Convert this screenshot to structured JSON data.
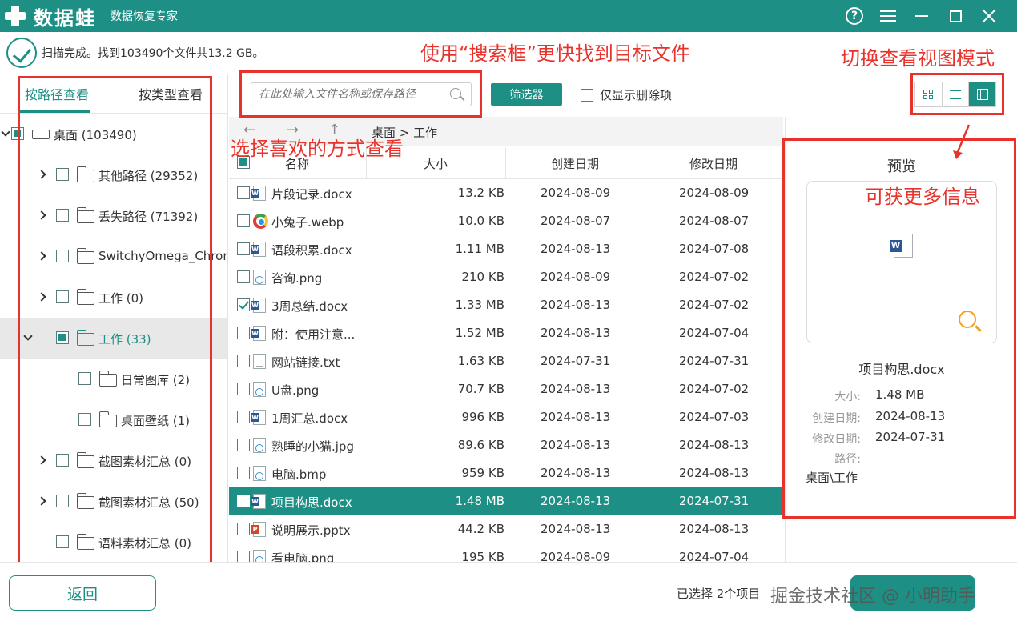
{
  "app": {
    "logo_name": "数据蛙",
    "subtitle": "数据恢复专家"
  },
  "status": {
    "text": "扫描完成。找到103490个文件共13.2 GB。"
  },
  "annotations": {
    "search_hint": "使用“搜索框”更快找到目标文件",
    "view_hint": "切换查看视图模式",
    "tree_hint": "选择喜欢的方式查看",
    "preview_hint": "可获更多信息"
  },
  "tabs": {
    "by_path": "按路径查看",
    "by_type": "按类型查看"
  },
  "tree": [
    {
      "label": "桌面 (103490)",
      "level": 0,
      "expander": "down",
      "check": "partial",
      "icon": "drive",
      "selected": false
    },
    {
      "label": "其他路径 (29352)",
      "level": 1,
      "expander": "right",
      "check": "none",
      "icon": "folder",
      "selected": false
    },
    {
      "label": "丢失路径 (71392)",
      "level": 1,
      "expander": "right",
      "check": "none",
      "icon": "folder",
      "selected": false
    },
    {
      "label": "SwitchyOmega_Chromium",
      "level": 1,
      "expander": "right",
      "check": "none",
      "icon": "folder",
      "selected": false
    },
    {
      "label": "工作 (0)",
      "level": 1,
      "expander": "right",
      "check": "none",
      "icon": "folder",
      "selected": false
    },
    {
      "label": "工作 (33)",
      "level": 1,
      "expander": "down",
      "check": "partial",
      "icon": "folder",
      "selected": true
    },
    {
      "label": "日常图库 (2)",
      "level": 2,
      "expander": "none",
      "check": "none",
      "icon": "folder",
      "selected": false
    },
    {
      "label": "桌面壁纸 (1)",
      "level": 2,
      "expander": "none",
      "check": "none",
      "icon": "folder",
      "selected": false
    },
    {
      "label": "截图素材汇总 (0)",
      "level": 1,
      "expander": "right",
      "check": "none",
      "icon": "folder",
      "selected": false
    },
    {
      "label": "截图素材汇总 (50)",
      "level": 1,
      "expander": "right",
      "check": "none",
      "icon": "folder",
      "selected": false
    },
    {
      "label": "语料素材汇总 (0)",
      "level": 1,
      "expander": "none",
      "check": "none",
      "icon": "folder",
      "selected": false
    }
  ],
  "toolbar": {
    "search_placeholder": "在此处输入文件名称或保存路径",
    "filter_label": "筛选器",
    "deleted_only_label": "仅显示删除项"
  },
  "nav": {
    "back": "←",
    "forward": "→",
    "up": "↑",
    "breadcrumb": "桌面 > 工作"
  },
  "columns": {
    "name": "名称",
    "size": "大小",
    "created": "创建日期",
    "modified": "修改日期"
  },
  "files": [
    {
      "name": "片段记录.docx",
      "type": "docx",
      "size": "13.2 KB",
      "created": "2024-08-09",
      "modified": "2024-08-09",
      "checked": false,
      "selected": false
    },
    {
      "name": "小兔子.webp",
      "type": "webp",
      "size": "10.0 KB",
      "created": "2024-08-07",
      "modified": "2024-08-07",
      "checked": false,
      "selected": false
    },
    {
      "name": "语段积累.docx",
      "type": "docx",
      "size": "1.11 MB",
      "created": "2024-08-13",
      "modified": "2024-07-08",
      "checked": false,
      "selected": false
    },
    {
      "name": "咨询.png",
      "type": "png",
      "size": "210 KB",
      "created": "2024-08-09",
      "modified": "2024-07-02",
      "checked": false,
      "selected": false
    },
    {
      "name": "3周总结.docx",
      "type": "docx",
      "size": "1.33 MB",
      "created": "2024-08-13",
      "modified": "2024-07-02",
      "checked": true,
      "selected": false
    },
    {
      "name": "附：使用注意...",
      "type": "docx",
      "size": "1.52 MB",
      "created": "2024-08-13",
      "modified": "2024-07-04",
      "checked": false,
      "selected": false
    },
    {
      "name": "网站链接.txt",
      "type": "txt",
      "size": "1.63 KB",
      "created": "2024-07-31",
      "modified": "2024-07-31",
      "checked": false,
      "selected": false
    },
    {
      "name": "U盘.png",
      "type": "png",
      "size": "70.7 KB",
      "created": "2024-08-13",
      "modified": "2024-07-02",
      "checked": false,
      "selected": false
    },
    {
      "name": "1周汇总.docx",
      "type": "docx",
      "size": "996 KB",
      "created": "2024-08-13",
      "modified": "2024-07-03",
      "checked": false,
      "selected": false
    },
    {
      "name": "熟睡的小猫.jpg",
      "type": "jpg",
      "size": "89.6 KB",
      "created": "2024-08-13",
      "modified": "2024-08-13",
      "checked": false,
      "selected": false
    },
    {
      "name": "电脑.bmp",
      "type": "bmp",
      "size": "959 KB",
      "created": "2024-08-13",
      "modified": "2024-08-13",
      "checked": false,
      "selected": false
    },
    {
      "name": "项目构思.docx",
      "type": "docx",
      "size": "1.48 MB",
      "created": "2024-08-13",
      "modified": "2024-07-31",
      "checked": false,
      "selected": true
    },
    {
      "name": "说明展示.pptx",
      "type": "pptx",
      "size": "44.2 KB",
      "created": "2024-08-13",
      "modified": "2024-08-13",
      "checked": false,
      "selected": false
    },
    {
      "name": "看电脑.png",
      "type": "png",
      "size": "195 KB",
      "created": "2024-08-09",
      "modified": "2024-07-04",
      "checked": false,
      "selected": false
    }
  ],
  "preview": {
    "title": "预览",
    "file_name": "项目构思.docx",
    "size_label": "大小:",
    "size": "1.48 MB",
    "created_label": "创建日期:",
    "created": "2024-08-13",
    "modified_label": "修改日期:",
    "modified": "2024-07-31",
    "path_label": "路径:",
    "path": "桌面\\工作"
  },
  "bottom": {
    "back_label": "返回",
    "selected_info": "已选择 2个项目",
    "watermark": "掘金技术社区 @ 小明助手"
  }
}
